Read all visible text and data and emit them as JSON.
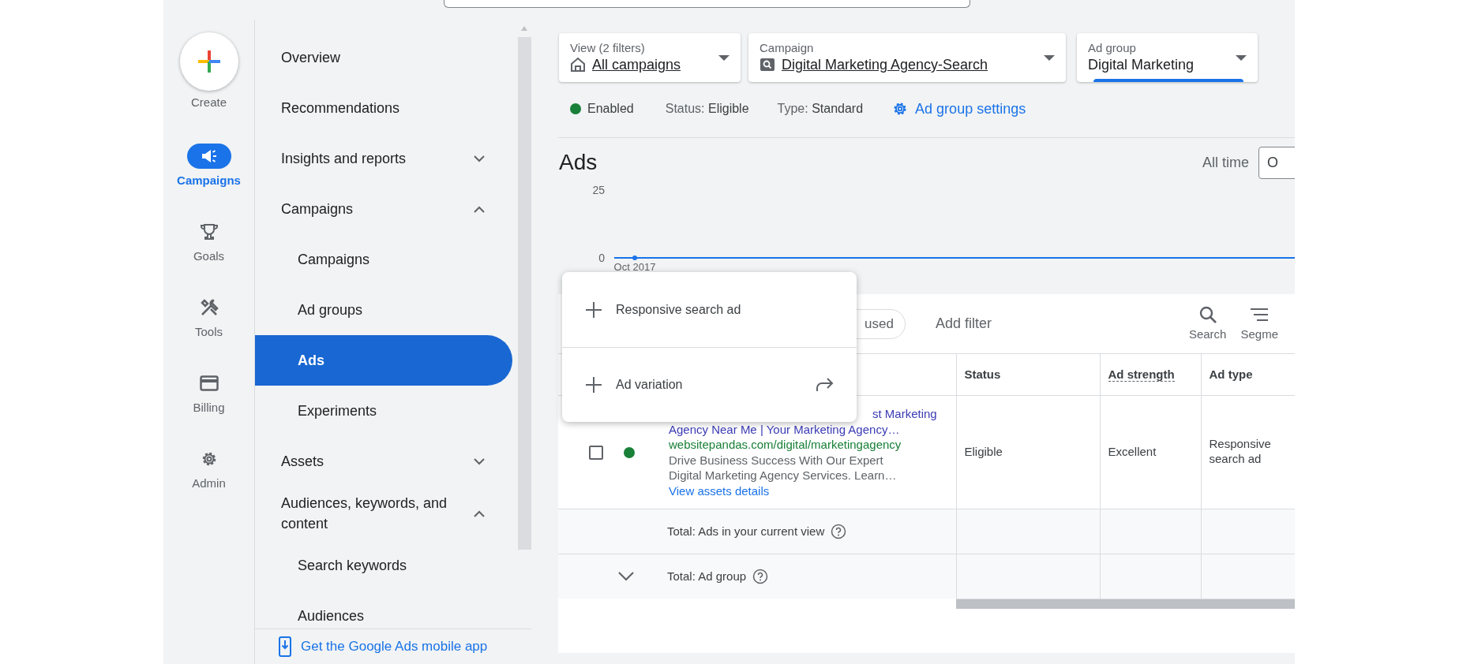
{
  "rail": {
    "create": {
      "label": "Create"
    },
    "items": [
      {
        "label": "Campaigns",
        "kind": "campaigns",
        "selected": true
      },
      {
        "label": "Goals",
        "kind": "goals",
        "selected": false
      },
      {
        "label": "Tools",
        "kind": "tools",
        "selected": false
      },
      {
        "label": "Billing",
        "kind": "billing",
        "selected": false
      },
      {
        "label": "Admin",
        "kind": "admin",
        "selected": false
      }
    ]
  },
  "nav": {
    "items": [
      {
        "label": "Overview",
        "selected": false
      },
      {
        "label": "Recommendations",
        "selected": false
      },
      {
        "label": "Insights and reports",
        "selected": false,
        "expanded": false
      },
      {
        "label": "Campaigns",
        "selected": false,
        "expanded": true,
        "children": [
          {
            "label": "Campaigns",
            "selected": false
          },
          {
            "label": "Ad groups",
            "selected": false
          },
          {
            "label": "Ads",
            "selected": true
          },
          {
            "label": "Experiments",
            "selected": false
          }
        ]
      },
      {
        "label": "Assets",
        "selected": false,
        "expanded": false
      },
      {
        "label": "Audiences, keywords, and content",
        "selected": false,
        "expanded": true,
        "children": [
          {
            "label": "Search keywords",
            "selected": false
          },
          {
            "label": "Audiences",
            "selected": false
          }
        ]
      }
    ],
    "footer": "Get the Google Ads mobile app"
  },
  "filters": [
    {
      "label": "View (2 filters)",
      "value": "All campaigns",
      "kind": "view",
      "selected": false
    },
    {
      "label": "Campaign",
      "value": "Digital Marketing Agency-Search",
      "kind": "campaign",
      "selected": false
    },
    {
      "label": "Ad group",
      "value": "Digital Marketing",
      "kind": "ad_group",
      "selected": true
    }
  ],
  "ad_group_status": {
    "state": "Enabled",
    "color": "#188038",
    "status_label": "Status:",
    "status": "Eligible",
    "type_label": "Type:",
    "type": "Standard",
    "settings_link": "Ad group settings"
  },
  "ads": {
    "title": "Ads",
    "date_range_label": "All time",
    "date_range_value": "O",
    "chart_data": {
      "type": "line",
      "x": [
        "Oct 2017"
      ],
      "series": [
        {
          "color": "#1a73e8",
          "marker": "circle",
          "values": [
            0
          ]
        }
      ],
      "ylim": [
        0,
        25
      ],
      "yticks": [
        0,
        25
      ]
    },
    "toolbar": {
      "chip": "used",
      "add_filter": "Add filter",
      "tools": [
        {
          "label": "Search",
          "kind": "search"
        },
        {
          "label": "Segme",
          "kind": "segment"
        }
      ]
    },
    "table": {
      "columns": [
        {
          "label": "Status",
          "dashed_underline": false
        },
        {
          "label": "Ad strength",
          "dashed_underline": true
        },
        {
          "label": "Ad type",
          "dashed_underline": false
        }
      ],
      "rows": [
        {
          "checked": false,
          "color": "#188038",
          "headline_lines": [
            "st Marketing",
            "Agency Near Me | Your Marketing Agency…"
          ],
          "url": "websitepandas.com/digital/marketingagency",
          "description_lines": [
            "Drive Business Success With Our Expert",
            "Digital Marketing Agency Services. Learn…"
          ],
          "details_link": "View assets details",
          "status": "Eligible",
          "ad_strength": "Excellent",
          "ad_type": "Responsive search ad"
        }
      ],
      "totals": [
        {
          "label": "Total: Ads in your current view",
          "expandable": false
        },
        {
          "label": "Total: Ad group",
          "expandable": true
        }
      ]
    }
  },
  "new_ad_menu": {
    "items": [
      {
        "label": "Responsive search ad",
        "kind": "create"
      },
      {
        "label": "Ad variation",
        "kind": "create_next"
      }
    ]
  }
}
